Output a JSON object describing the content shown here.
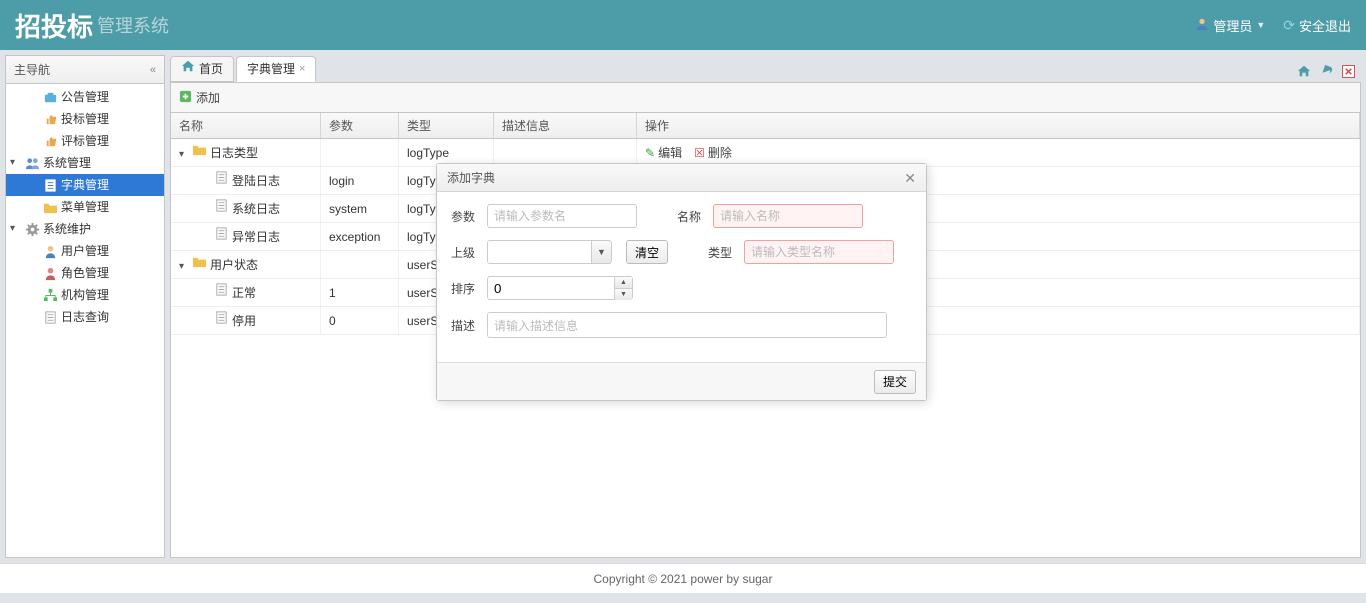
{
  "header": {
    "logo_main": "招投标",
    "logo_sub": "管理系统",
    "user_label": "管理员",
    "logout_label": "安全退出"
  },
  "sidebar": {
    "title": "主导航",
    "nodes": [
      {
        "label": "公告管理",
        "icon": "briefcase",
        "indent": 1,
        "expander": ""
      },
      {
        "label": "投标管理",
        "icon": "thumb",
        "indent": 1,
        "expander": ""
      },
      {
        "label": "评标管理",
        "icon": "thumb",
        "indent": 1,
        "expander": ""
      },
      {
        "label": "系统管理",
        "icon": "people",
        "indent": 0,
        "expander": "▾"
      },
      {
        "label": "字典管理",
        "icon": "page-sel",
        "indent": 1,
        "expander": "",
        "selected": true
      },
      {
        "label": "菜单管理",
        "icon": "folder",
        "indent": 1,
        "expander": ""
      },
      {
        "label": "系统维护",
        "icon": "gear",
        "indent": 0,
        "expander": "▾"
      },
      {
        "label": "用户管理",
        "icon": "person",
        "indent": 1,
        "expander": ""
      },
      {
        "label": "角色管理",
        "icon": "role",
        "indent": 1,
        "expander": ""
      },
      {
        "label": "机构管理",
        "icon": "org",
        "indent": 1,
        "expander": ""
      },
      {
        "label": "日志查询",
        "icon": "page",
        "indent": 1,
        "expander": ""
      }
    ]
  },
  "tabs": {
    "home_label": "首页",
    "active_label": "字典管理"
  },
  "toolbar": {
    "add_label": "添加"
  },
  "grid": {
    "headers": {
      "name": "名称",
      "param": "参数",
      "type": "类型",
      "desc": "描述信息",
      "ops": "操作"
    },
    "ops": {
      "edit": "编辑",
      "delete": "删除"
    },
    "rows": [
      {
        "name": "日志类型",
        "param": "",
        "type": "logType",
        "indent": 0,
        "expander": "▾",
        "folder": true,
        "ops": true
      },
      {
        "name": "登陆日志",
        "param": "login",
        "type": "logType",
        "indent": 1,
        "expander": "",
        "folder": false,
        "ops": false
      },
      {
        "name": "系统日志",
        "param": "system",
        "type": "logType",
        "indent": 1,
        "expander": "",
        "folder": false,
        "ops": false
      },
      {
        "name": "异常日志",
        "param": "exception",
        "type": "logType",
        "indent": 1,
        "expander": "",
        "folder": false,
        "ops": false
      },
      {
        "name": "用户状态",
        "param": "",
        "type": "userSta",
        "indent": 0,
        "expander": "▾",
        "folder": true,
        "ops": false
      },
      {
        "name": "正常",
        "param": "1",
        "type": "userSta",
        "indent": 1,
        "expander": "",
        "folder": false,
        "ops": false
      },
      {
        "name": "停用",
        "param": "0",
        "type": "userSta",
        "indent": 1,
        "expander": "",
        "folder": false,
        "ops": false
      }
    ]
  },
  "dialog": {
    "title": "添加字典",
    "labels": {
      "param": "参数",
      "name": "名称",
      "parent": "上级",
      "type": "类型",
      "order": "排序",
      "desc": "描述"
    },
    "placeholders": {
      "param": "请输入参数名",
      "name": "请输入名称",
      "type": "请输入类型名称",
      "desc": "请输入描述信息"
    },
    "clear_btn": "清空",
    "order_value": "0",
    "submit": "提交"
  },
  "footer": "Copyright © 2021 power by sugar"
}
